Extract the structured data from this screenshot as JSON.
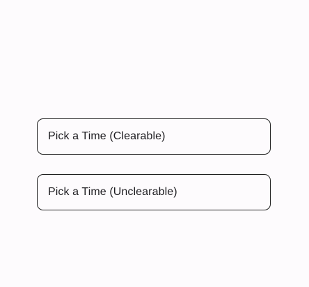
{
  "fields": [
    {
      "label": "Pick a Time (Clearable)"
    },
    {
      "label": "Pick a Time (Unclearable)"
    }
  ]
}
